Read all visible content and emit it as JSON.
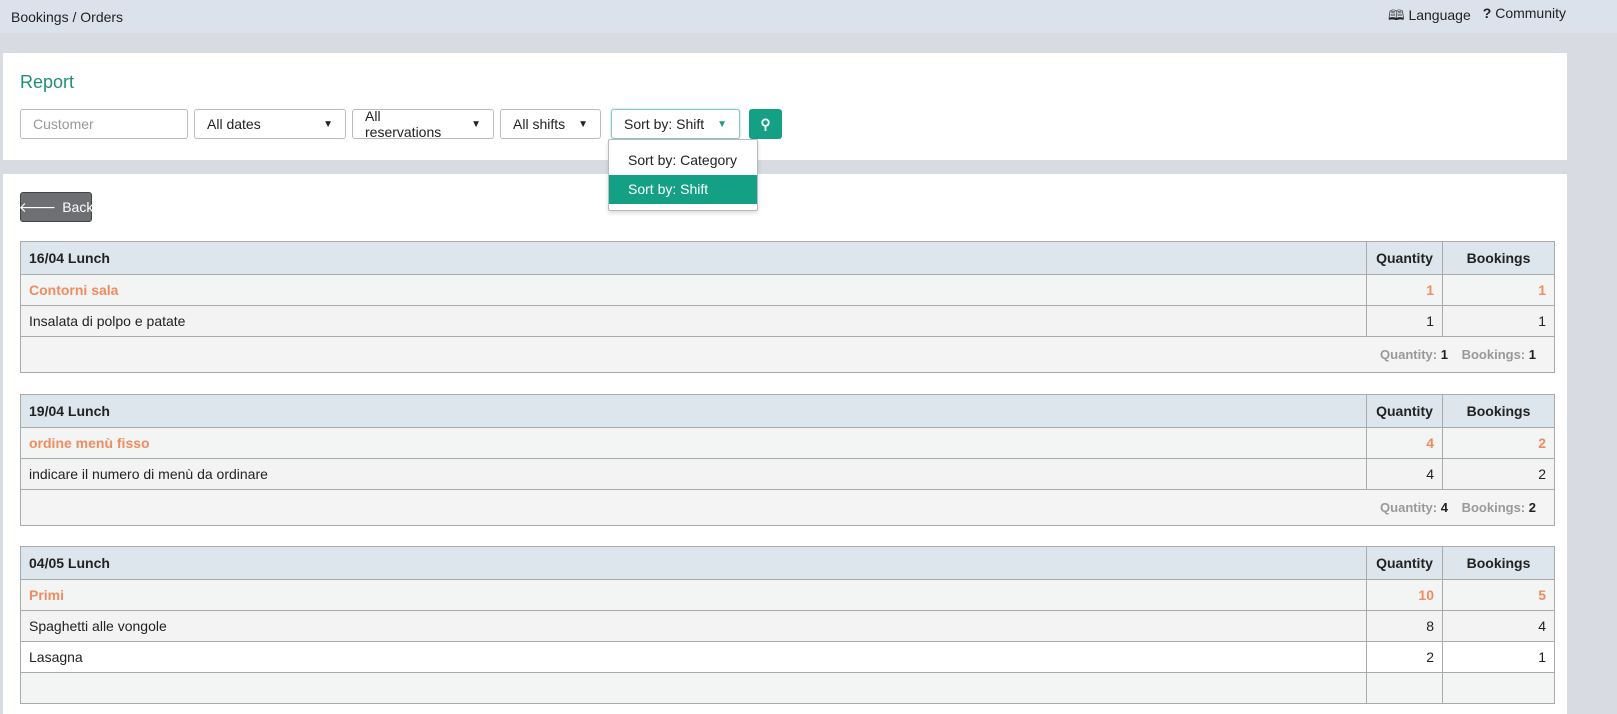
{
  "topbar": {
    "breadcrumb": "Bookings / Orders",
    "language": "Language",
    "community": "Community"
  },
  "report": {
    "title": "Report",
    "customer_placeholder": "Customer",
    "dates": "All dates",
    "reservations": "All reservations",
    "shifts": "All shifts",
    "sort": "Sort by: Shift",
    "sort_options": [
      "Sort by: Category",
      "Sort by: Shift"
    ]
  },
  "back_label": "Back",
  "col_quantity": "Quantity",
  "col_bookings": "Bookings",
  "total_quantity_label": "Quantity:",
  "total_bookings_label": "Bookings:",
  "groups": [
    {
      "title": "16/04 Lunch",
      "category": {
        "name": "Contorni sala",
        "quantity": "1",
        "bookings": "1"
      },
      "items": [
        {
          "name": "Insalata di polpo e patate",
          "quantity": "1",
          "bookings": "1"
        }
      ],
      "total_quantity": "1",
      "total_bookings": "1"
    },
    {
      "title": "19/04 Lunch",
      "category": {
        "name": "ordine menù fisso",
        "quantity": "4",
        "bookings": "2"
      },
      "items": [
        {
          "name": "indicare il numero di menù da ordinare",
          "quantity": "4",
          "bookings": "2"
        }
      ],
      "total_quantity": "4",
      "total_bookings": "2"
    },
    {
      "title": "04/05 Lunch",
      "category": {
        "name": "Primi",
        "quantity": "10",
        "bookings": "5"
      },
      "items": [
        {
          "name": "Spaghetti alle vongole",
          "quantity": "8",
          "bookings": "4"
        },
        {
          "name": "Lasagna",
          "quantity": "2",
          "bookings": "1"
        }
      ]
    }
  ]
}
